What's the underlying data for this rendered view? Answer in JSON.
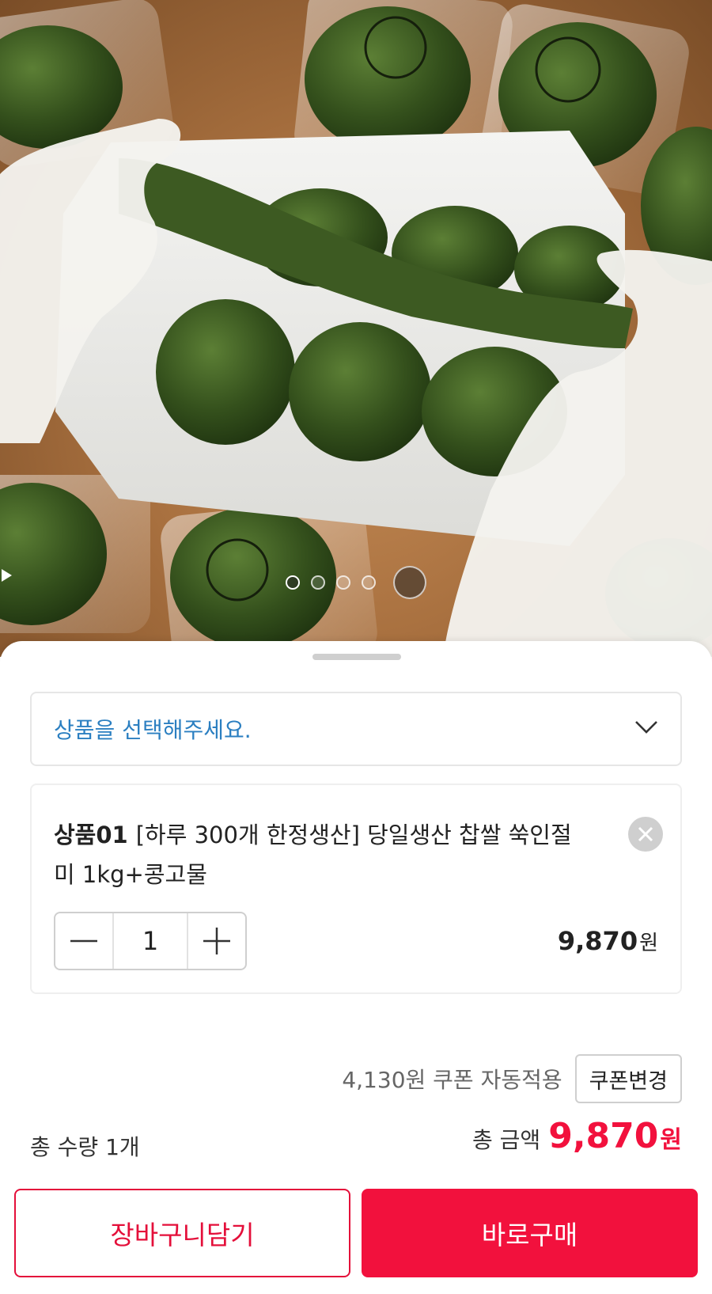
{
  "gallery": {
    "dots": [
      true,
      false,
      false,
      false
    ],
    "play_icon": "play-icon"
  },
  "option_select": {
    "placeholder": "상품을 선택해주세요.",
    "icon": "chevron-down-icon"
  },
  "selected_item": {
    "code": "상품01",
    "title": "[하루 300개 한정생산] 당일생산 찹쌀 쑥인절미 1kg+콩고물",
    "quantity": "1",
    "price": "9,870",
    "unit": "원"
  },
  "coupon": {
    "text": "4,130원 쿠폰 자동적용",
    "button": "쿠폰변경"
  },
  "totals": {
    "quantity": "총 수량 1개",
    "amount_label": "총 금액",
    "amount": "9,870",
    "unit": "원"
  },
  "actions": {
    "cart": "장바구니담기",
    "buy": "바로구매"
  },
  "colors": {
    "accent": "#f2113d",
    "link": "#2b7fc1"
  }
}
